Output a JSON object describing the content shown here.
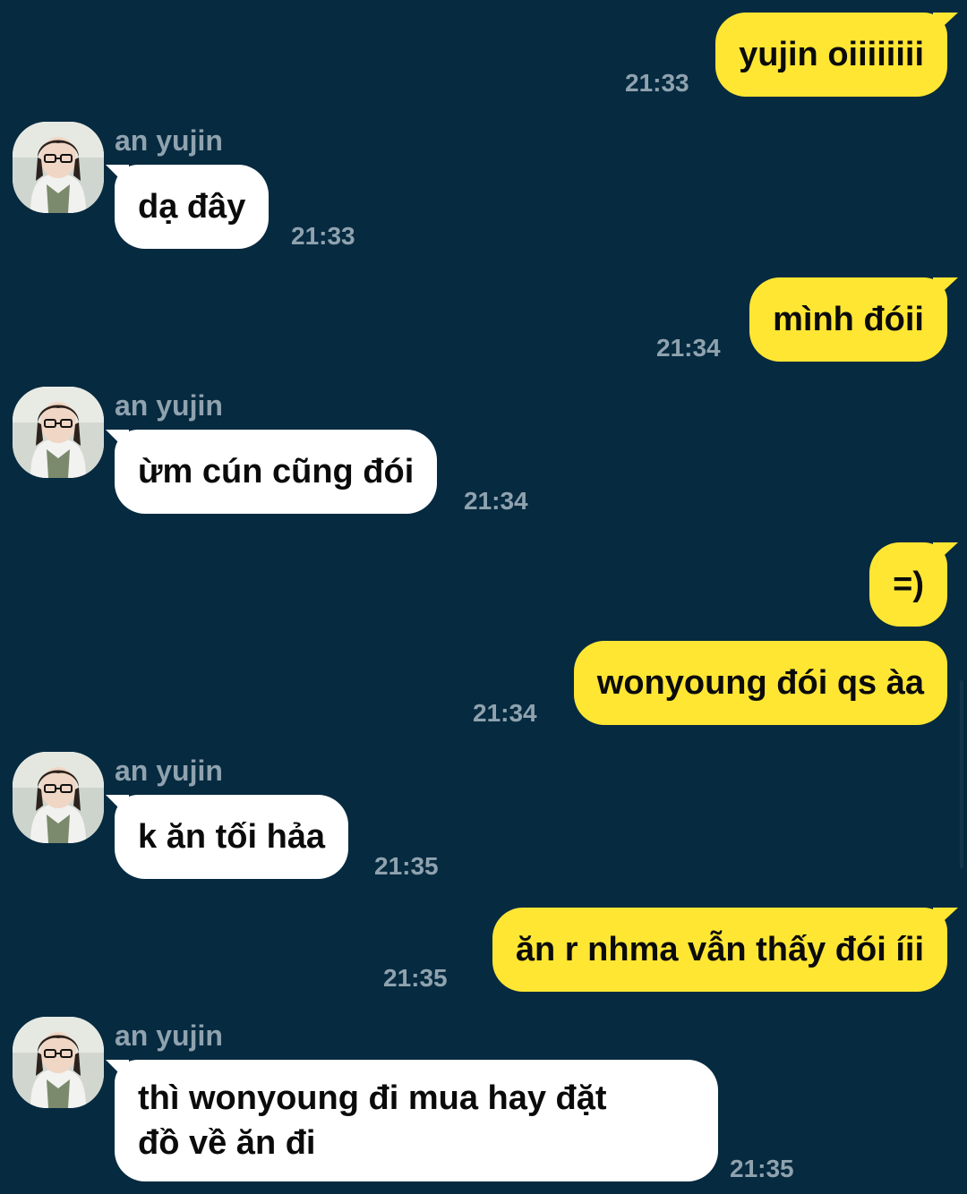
{
  "contact": {
    "name": "an yujin"
  },
  "messages": [
    {
      "dir": "out",
      "text": "yujin oiiiiiiii",
      "time": "21:33"
    },
    {
      "dir": "in",
      "sender": "an yujin",
      "text": "dạ đây",
      "time": "21:33"
    },
    {
      "dir": "out",
      "text": "mình đóii",
      "time": "21:34"
    },
    {
      "dir": "in",
      "sender": "an yujin",
      "text": "ừm cún cũng đói",
      "time": "21:34"
    },
    {
      "dir": "out",
      "text": "=)",
      "time": ""
    },
    {
      "dir": "out",
      "text": "wonyoung đói qs àa",
      "time": "21:34"
    },
    {
      "dir": "in",
      "sender": "an yujin",
      "text": "k ăn tối hảa",
      "time": "21:35"
    },
    {
      "dir": "out",
      "text": "ăn r nhma vẫn thấy đói íii",
      "time": "21:35"
    },
    {
      "dir": "in",
      "sender": "an yujin",
      "lines": [
        "thì wonyoung đi mua hay đặt",
        "đồ về ăn đi"
      ],
      "time": "21:35"
    }
  ],
  "colors": {
    "background": "#062a40",
    "outgoing_bubble": "#ffe633",
    "incoming_bubble": "#ffffff",
    "meta_text": "#8fa2ae"
  }
}
